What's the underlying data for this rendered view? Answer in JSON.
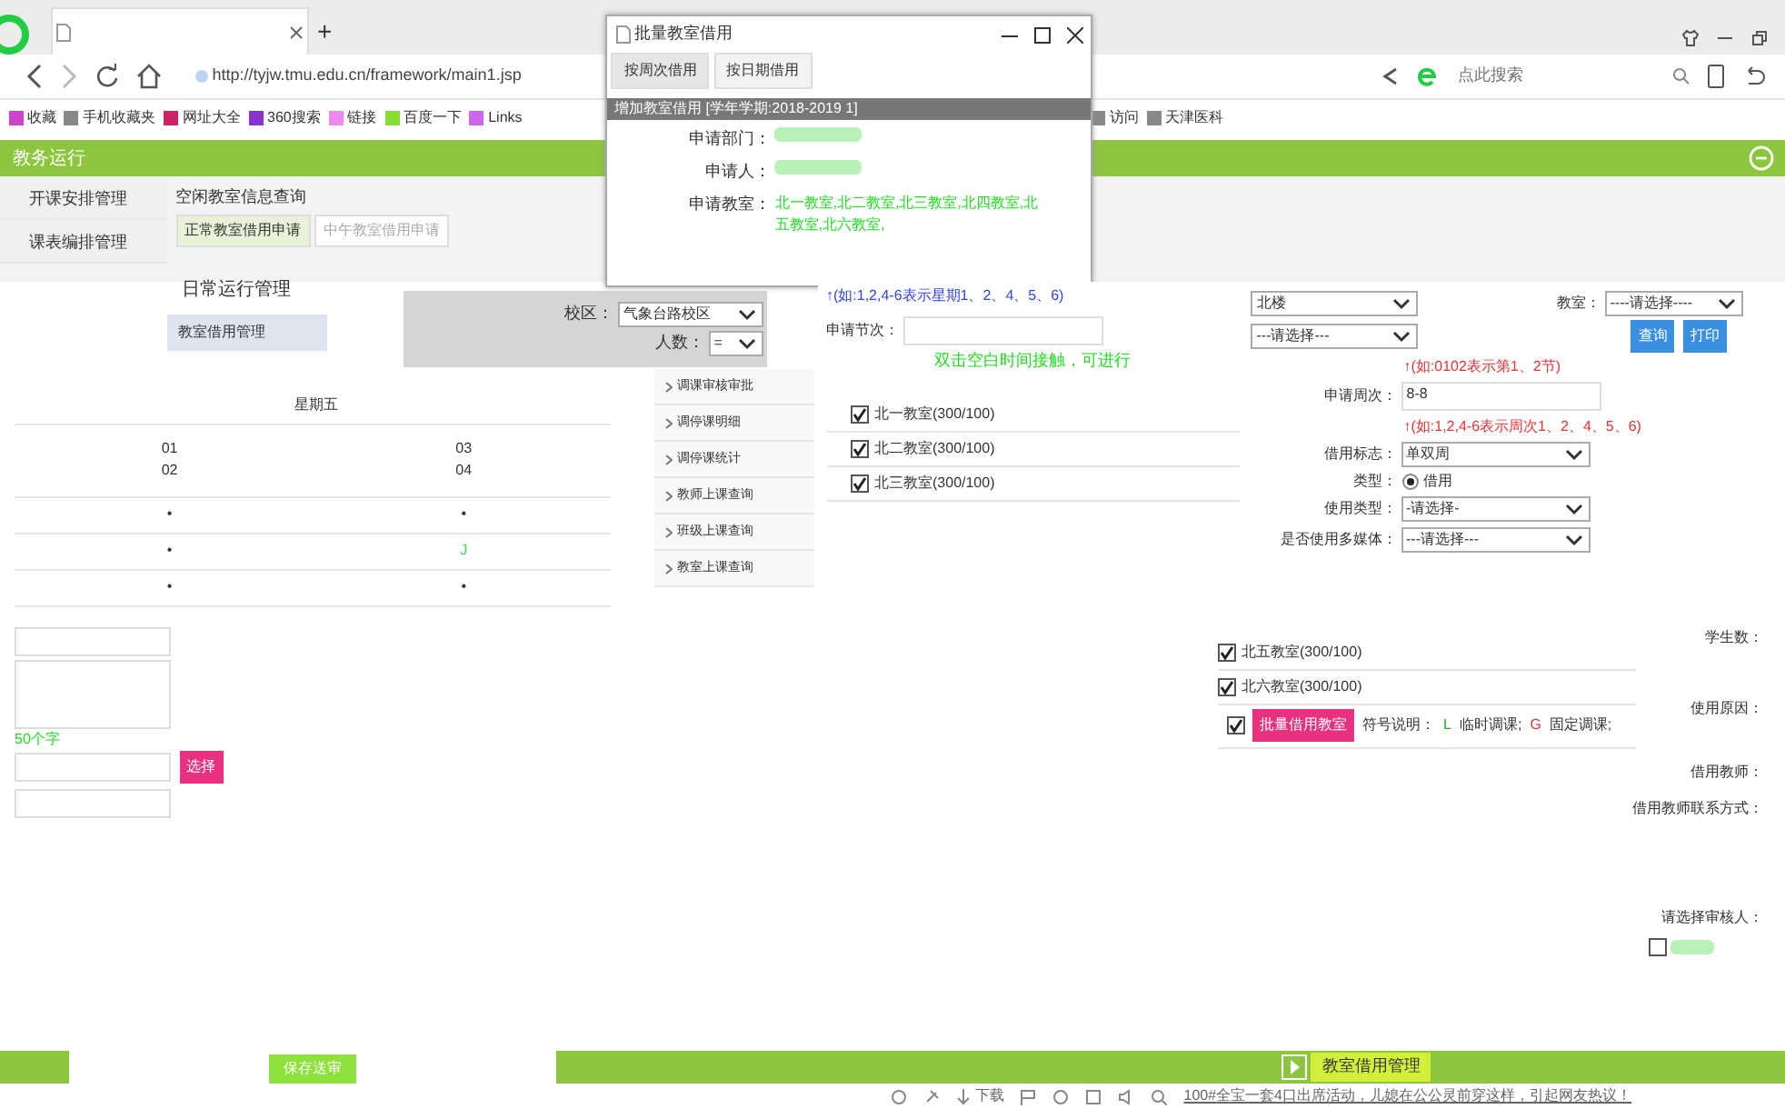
{
  "browser": {
    "new_tab": "+",
    "address": "http://tyjw.tmu.edu.cn/framework/main1.jsp",
    "search_placeholder": "点此搜索",
    "bookmarks": [
      "收藏",
      "手机收藏夹",
      "网址大全",
      "360搜索",
      "链接",
      "百度一下",
      "Links"
    ],
    "bookmarks_right": [
      "访问",
      "天津医科"
    ]
  },
  "app": {
    "title": "教务运行",
    "sidebar": [
      {
        "label": "开课安排管理",
        "selected": false
      },
      {
        "label": "课表编排管理",
        "selected": false
      }
    ],
    "page_title": "空闲教室信息查询",
    "tabs": [
      {
        "label": "正常教室借用申请",
        "selected": true
      },
      {
        "label": "中午教室借用申请",
        "selected": false
      }
    ],
    "submenu_title": "日常运行管理",
    "submenu": [
      {
        "label": "教室借用管理",
        "selected": true
      }
    ],
    "submenu_2": [
      {
        "label": "调课审核审批",
        "selected": false
      },
      {
        "label": "调停课明细",
        "selected": false
      },
      {
        "label": "调停课统计",
        "selected": false
      },
      {
        "label": "教师上课查询",
        "selected": false
      },
      {
        "label": "班级上课查询",
        "selected": false
      },
      {
        "label": "教室上课查询",
        "selected": false
      }
    ],
    "filters": [
      {
        "label": "校区：",
        "value": "气象台路校区"
      },
      {
        "label": "人数：",
        "value": "="
      }
    ]
  },
  "dialog": {
    "title": "批量教室借用",
    "tabs": [
      {
        "label": "按周次借用",
        "selected": true
      },
      {
        "label": "按日期借用",
        "selected": false
      }
    ],
    "heading": "增加教室借用 [学年学期:2018-2019 1]",
    "fields": [
      {
        "label": "申请部门："
      },
      {
        "label": "申请人："
      },
      {
        "label": "申请教室：",
        "value": "北一教室,北二教室,北三教室,北四教室,北五教室,北六教室,"
      }
    ]
  },
  "schedule": {
    "day": "星期五",
    "periods": [
      "01\n02",
      "03\n04"
    ],
    "rows": [
      [
        "•",
        "•"
      ],
      [
        "•",
        "J"
      ],
      [
        "•",
        "•"
      ]
    ]
  },
  "form": {
    "weekday_hint": "↑(如:1,2,4-6表示星期1、2、4、5、6)",
    "period_label": "申请节次：",
    "note": "双击空白时间接触，可进行",
    "rooms": [
      {
        "label": "北一教室(300/100)",
        "checked": true
      },
      {
        "label": "北二教室(300/100)",
        "checked": true
      },
      {
        "label": "北三教室(300/100)",
        "checked": true
      },
      {
        "label": "北五教室(300/100)",
        "checked": true
      },
      {
        "label": "北六教室(300/100)",
        "checked": true
      }
    ],
    "batch": {
      "checked": true,
      "button": "批量借用教室",
      "legend_label": "符号说明：",
      "legend": [
        {
          "code": "L",
          "text": "临时调课;",
          "color": "#22aa22"
        },
        {
          "code": "G",
          "text": "固定调课;",
          "color": "#ee3333"
        }
      ]
    }
  },
  "query": {
    "building": "北楼",
    "room_label": "教室：",
    "room": "----请选择----",
    "select": "---请选择---",
    "buttons": [
      "查询",
      "打印"
    ],
    "period_hint": "↑(如:0102表示第1、2节)",
    "week_label": "申请周次：",
    "week": "8-8",
    "week_hint": "↑(如:1,2,4-6表示周次1、2、4、5、6)",
    "flag_label": "借用标志：",
    "flag": "单双周",
    "type_label": "类型：",
    "type_option": {
      "label": "借用",
      "selected": true
    },
    "use_label": "使用类型：",
    "use": "-请选择-",
    "media_label": "是否使用多媒体：",
    "media": "---请选择---"
  },
  "right_labels": [
    "学生数：",
    "使用原因：",
    "借用教师：",
    "借用教师联系方式：",
    "请选择审核人："
  ],
  "reviewer_checked": false,
  "left": {
    "limit": "50个字",
    "choose": "选择",
    "save": "保存送审"
  },
  "bottom_tab": "教室借用管理",
  "status": {
    "download": "下载",
    "news": "100#全宝一套4口出席活动，儿媳在公公灵前穿这样，引起网友热议！"
  }
}
